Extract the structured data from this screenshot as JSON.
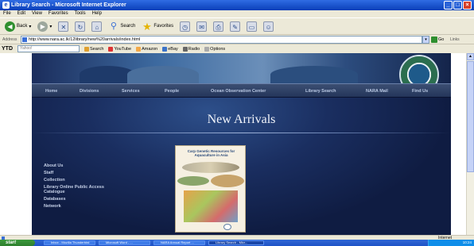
{
  "window": {
    "title": "Library Search - Microsoft Internet Explorer",
    "buttons": [
      "_",
      "□",
      "×"
    ]
  },
  "menu": [
    "File",
    "Edit",
    "View",
    "Favorites",
    "Tools",
    "Help"
  ],
  "toolbar": {
    "back": "Back",
    "search": "Search",
    "favorites": "Favorites"
  },
  "address": {
    "label": "Address",
    "url": "http://www.nara.ac.lk/12library/new%20arrivals/index.html",
    "go": "Go",
    "links": "Links"
  },
  "yahoo_toolbar": {
    "brand": "YTD",
    "search_placeholder": "Yahoo!",
    "search_btn": "Search",
    "items": [
      "YouTube",
      "Amazon",
      "eBay",
      "Radio",
      "Options"
    ]
  },
  "site": {
    "nav": [
      "Home",
      "Divisions",
      "Services",
      "People",
      "Ocean Observation Center",
      "Library Search",
      "NARA Mail",
      "Find Us"
    ],
    "heading": "New Arrivals",
    "side_links": [
      "About Us",
      "Staff",
      "Collection",
      "Library Online Public Access Catalogue",
      "Databases",
      "Network"
    ],
    "book_title": "Carp Genetic Resources for Aquaculture in Asia"
  },
  "status": {
    "zone": "Internet"
  },
  "taskbar": {
    "start": "start",
    "tasks": [
      "Inbox - Mozilla Thunderbird",
      "Microsoft Word - ...",
      "NARA Annual Report ...",
      "Library Search - Micr..."
    ],
    "clock": "10:24"
  },
  "colors": {
    "site_bg": "#0e1a3e",
    "nav_text": "#b9c8e3",
    "heading": "#f1f4fa"
  }
}
